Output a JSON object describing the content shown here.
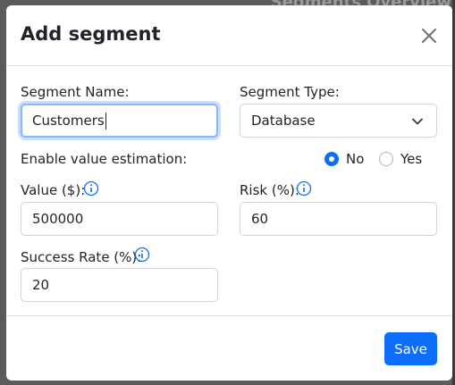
{
  "background": {
    "title": "Segments Overview"
  },
  "modal": {
    "title": "Add segment",
    "close_icon": "close-icon"
  },
  "form": {
    "segment_name": {
      "label": "Segment Name:",
      "value": "Customers"
    },
    "segment_type": {
      "label": "Segment Type:",
      "value": "Database"
    },
    "value_estimation": {
      "label": "Enable value estimation:",
      "options": [
        "No",
        "Yes"
      ],
      "selected": "No"
    },
    "value": {
      "label": "Value ($):",
      "value": "500000"
    },
    "risk": {
      "label": "Risk (%):",
      "value": "60"
    },
    "success_rate": {
      "label": "Success Rate (%):",
      "value": "20"
    }
  },
  "footer": {
    "save_label": "Save"
  },
  "colors": {
    "primary": "#0d6efd",
    "focus_ring": "#86b7fe",
    "border": "#ced4da",
    "text": "#212529"
  }
}
